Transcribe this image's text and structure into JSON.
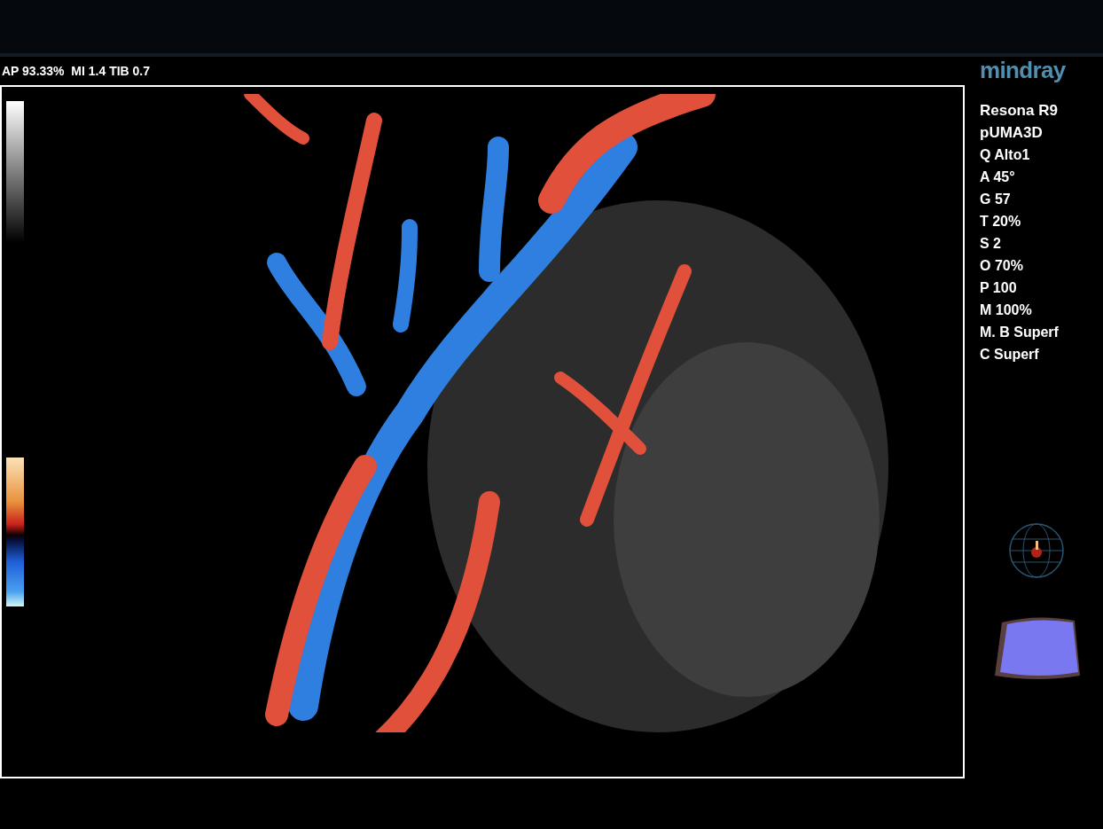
{
  "acoustic_output": "AP 93.33%  MI 1.4 TIB 0.7",
  "logo": "mindray",
  "parameters": [
    "Resona R9",
    "pUMA3D",
    "Q Alto1",
    "A 45°",
    "G 57",
    "T 20%",
    "S 2",
    "O 70%",
    "P 100",
    "M 100%",
    "M. B Superf",
    "C Superf"
  ]
}
